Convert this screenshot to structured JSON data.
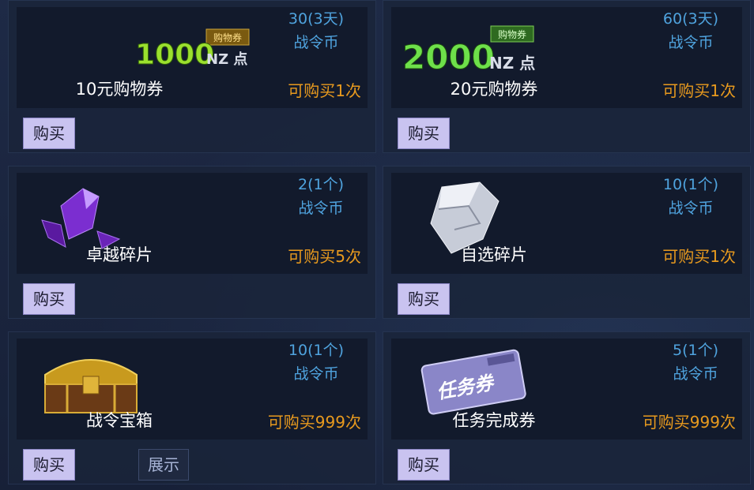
{
  "items": [
    {
      "name": "10元购物券",
      "price": "30(3天)",
      "currency": "战令币",
      "limit": "可购买1次",
      "buy": "购买",
      "icon": "1000-nz-points-voucher-icon",
      "art_number": "1000",
      "art_unit": "NZ 点",
      "art_tag": "购物券"
    },
    {
      "name": "20元购物券",
      "price": "60(3天)",
      "currency": "战令币",
      "limit": "可购买1次",
      "buy": "购买",
      "icon": "2000-nz-points-voucher-icon",
      "art_number": "2000",
      "art_unit": "NZ 点",
      "art_tag": "购物券"
    },
    {
      "name": "卓越碎片",
      "price": "2(1个)",
      "currency": "战令币",
      "limit": "可购买5次",
      "buy": "购买",
      "icon": "purple-crystal-shard-icon"
    },
    {
      "name": "自选碎片",
      "price": "10(1个)",
      "currency": "战令币",
      "limit": "可购买1次",
      "buy": "购买",
      "icon": "silver-crystal-shard-icon"
    },
    {
      "name": "战令宝箱",
      "price": "10(1个)",
      "currency": "战令币",
      "limit": "可购买999次",
      "buy": "购买",
      "show": "展示",
      "icon": "golden-treasure-chest-icon"
    },
    {
      "name": "任务完成券",
      "price": "5(1个)",
      "currency": "战令币",
      "limit": "可购买999次",
      "buy": "购买",
      "icon": "task-ticket-icon",
      "art_text": "任务券"
    }
  ]
}
